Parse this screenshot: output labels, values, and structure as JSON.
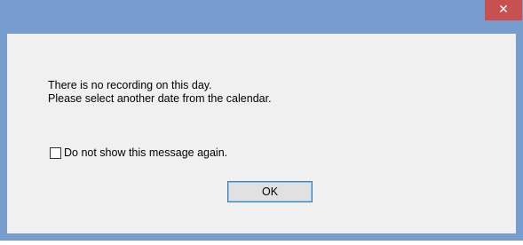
{
  "window": {
    "close_glyph": "✕",
    "close_icon": "close-icon",
    "titlebar_color": "#779cce",
    "close_color": "#c75050"
  },
  "message": {
    "line1": "There is no recording on this day.",
    "line2": "Please select another date from the calendar."
  },
  "checkbox": {
    "label": "Do not show this message again.",
    "checked": false
  },
  "buttons": {
    "ok_label": "OK"
  }
}
